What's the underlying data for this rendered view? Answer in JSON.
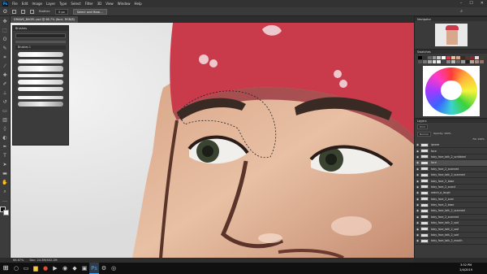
{
  "menubar": {
    "logo": "Ps",
    "items": [
      "File",
      "Edit",
      "Image",
      "Layer",
      "Type",
      "Select",
      "Filter",
      "3D",
      "View",
      "Window",
      "Help"
    ]
  },
  "options": {
    "feather_label": "Feather:",
    "feather_value": "0 px",
    "select_mask_label": "Select and Mask..."
  },
  "document": {
    "tab_title": "DRAWS_BAGEL.psd @ 66.7% (face, RGB/8)"
  },
  "brushes": {
    "panel_title": "Brushes",
    "group_label": "Brushes 1"
  },
  "panels": {
    "navigator": "Navigator",
    "swatches": "Swatches",
    "layers": "Layers",
    "kind_label": "Kind",
    "blend_mode": "Normal",
    "opacity": "Opacity: 100%",
    "fill": "Fill: 100%"
  },
  "layers": [
    {
      "name": "ignore",
      "selected": false
    },
    {
      "name": "face",
      "selected": false
    },
    {
      "name": "toby_face_talk_2_scribbled",
      "selected": false
    },
    {
      "name": "face",
      "selected": true
    },
    {
      "name": "toby_face_2_scanned",
      "selected": false
    },
    {
      "name": "toby_face_talk_2_scanned",
      "selected": false
    },
    {
      "name": "toby_face_2_base",
      "selected": false
    },
    {
      "name": "toby_face_2_scan4",
      "selected": false
    },
    {
      "name": "watch_a_laugh",
      "selected": false
    },
    {
      "name": "toby_face_2_scan",
      "selected": false
    },
    {
      "name": "toby_face_2_base",
      "selected": false
    },
    {
      "name": "toby_face_talk_2_scanned",
      "selected": false
    },
    {
      "name": "toby_face_2_scanned",
      "selected": false
    },
    {
      "name": "toby_face_talk_2_sad",
      "selected": false
    },
    {
      "name": "toby_face_talk_2_sad",
      "selected": false
    },
    {
      "name": "toby_face_talk_2_sad",
      "selected": false
    },
    {
      "name": "toby_face_talk_2_mouth",
      "selected": false
    }
  ],
  "status": {
    "zoom": "66.67%",
    "doc_size": "Doc: 24.3M/402.2M"
  },
  "clock": {
    "time": "3:52 PM",
    "date": "2/4/2019"
  },
  "colors": {
    "accent": "#31a8ff",
    "bandana": "#c93a4b",
    "skin": "#e8c0a4"
  }
}
